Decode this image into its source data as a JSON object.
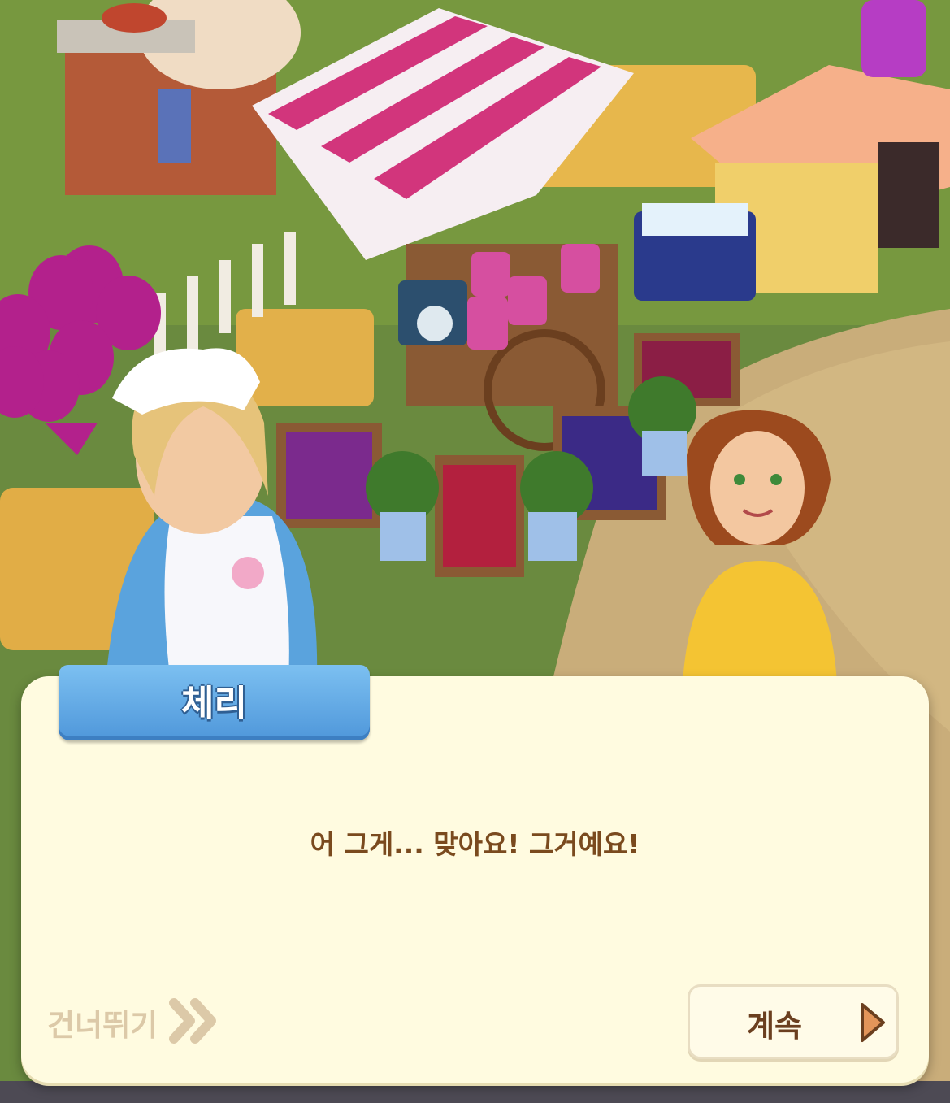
{
  "dialog": {
    "speaker_name": "체리",
    "message": "어 그게... 맞아요! 그거예요!",
    "skip_label": "건너뛰기",
    "continue_label": "계속"
  },
  "colors": {
    "dialog_bg": "#fffbe0",
    "name_tag": "#5aa6e4",
    "message_text": "#7a4a1e",
    "skip_text": "#dcc9a8",
    "continue_arrow": "#d98a4e"
  },
  "icons": {
    "skip": "double-chevron-right-icon",
    "continue": "play-triangle-icon"
  }
}
